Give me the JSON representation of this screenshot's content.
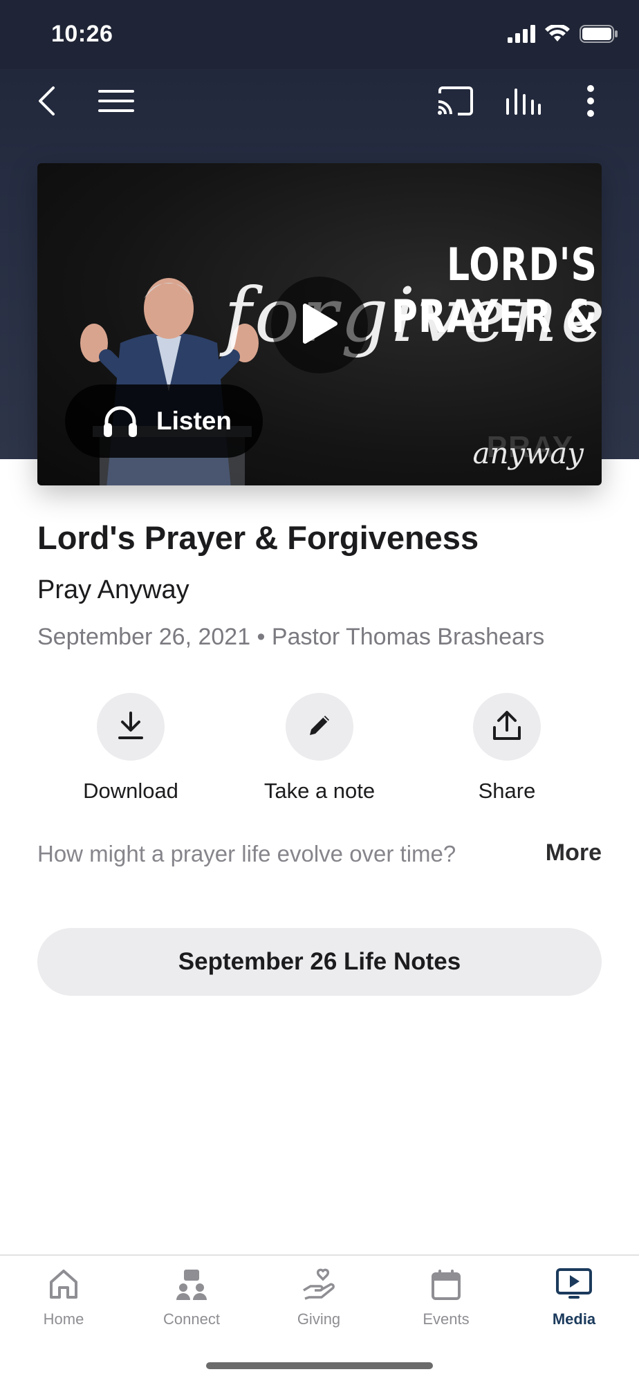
{
  "status_bar": {
    "time": "10:26"
  },
  "colors": {
    "header_bg": "#262d42",
    "accent": "#1b3a5c",
    "action_bg": "#ececee"
  },
  "nav": {
    "back_icon": "chevron-left-icon",
    "menu_icon": "hamburger-menu-icon",
    "cast_icon": "cast-icon",
    "audio_icon": "audio-levels-icon",
    "more_icon": "vertical-dots-icon"
  },
  "video": {
    "title_line1": "LORD'S PRAYER &",
    "title_line2": "forgiveness",
    "brand_bg": "PRAY",
    "brand": "anyway",
    "listen_label": "Listen",
    "play_icon": "play-icon",
    "listen_icon": "headphones-icon"
  },
  "sermon": {
    "title": "Lord's Prayer & Forgiveness",
    "series": "Pray Anyway",
    "meta": "September 26, 2021 • Pastor Thomas Brashears",
    "description": "How might a prayer life evolve over time?",
    "more_label": "More"
  },
  "actions": [
    {
      "label": "Download",
      "icon": "download-icon"
    },
    {
      "label": "Take a note",
      "icon": "pencil-icon"
    },
    {
      "label": "Share",
      "icon": "share-icon"
    }
  ],
  "notes_button": {
    "label": "September 26 Life Notes"
  },
  "tabs": [
    {
      "label": "Home",
      "icon": "home-icon",
      "active": false
    },
    {
      "label": "Connect",
      "icon": "connect-icon",
      "active": false
    },
    {
      "label": "Giving",
      "icon": "giving-icon",
      "active": false
    },
    {
      "label": "Events",
      "icon": "calendar-icon",
      "active": false
    },
    {
      "label": "Media",
      "icon": "media-icon",
      "active": true
    }
  ]
}
